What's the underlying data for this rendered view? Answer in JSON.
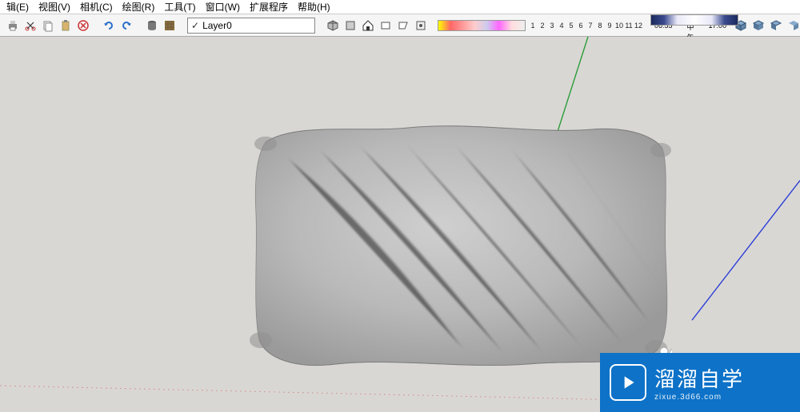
{
  "menu": {
    "items": [
      "辑(E)",
      "视图(V)",
      "相机(C)",
      "绘图(R)",
      "工具(T)",
      "窗口(W)",
      "扩展程序",
      "帮助(H)"
    ]
  },
  "toolbar": {
    "layer_name": "Layer0",
    "time": {
      "start": "06:55",
      "mid": "中午",
      "end": "17:00"
    },
    "numbers": [
      "1",
      "2",
      "3",
      "4",
      "5",
      "6",
      "7",
      "8",
      "9",
      "10",
      "11",
      "12"
    ]
  },
  "watermark": {
    "title": "溜溜自学",
    "sub": "zixue.3d66.com"
  },
  "icons": {
    "print": "print-icon",
    "scissors": "scissors-icon",
    "page": "page-icon",
    "delete": "delete-icon",
    "undo": "undo-icon",
    "redo": "redo-icon",
    "db": "database-icon",
    "box": "box-icon",
    "house": "house-icon",
    "components": "component-icon",
    "v1": "view3d-1",
    "v2": "view3d-2",
    "v3": "view3d-3",
    "v4": "view3d-4",
    "v5": "view3d-5",
    "v6": "view3d-6"
  }
}
